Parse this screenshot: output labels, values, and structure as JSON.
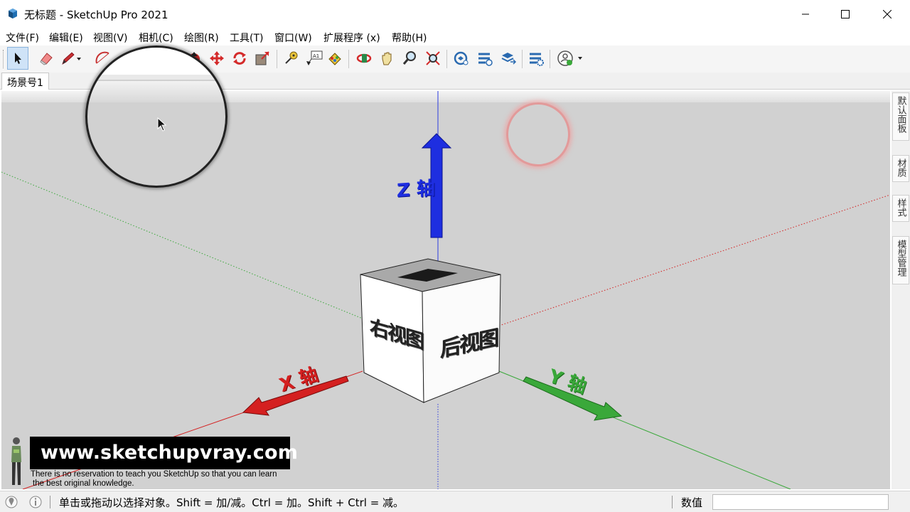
{
  "window": {
    "title": "无标题 - SketchUp Pro 2021"
  },
  "menu": [
    {
      "label": "文件(F)"
    },
    {
      "label": "编辑(E)"
    },
    {
      "label": "视图(V)"
    },
    {
      "label": "相机(C)"
    },
    {
      "label": "绘图(R)"
    },
    {
      "label": "工具(T)"
    },
    {
      "label": "窗口(W)"
    },
    {
      "label": "扩展程序 (x)"
    },
    {
      "label": "帮助(H)"
    }
  ],
  "toolbar": {
    "tools": [
      "select-icon",
      "eraser-icon",
      "pencil-icon",
      "arc-icon",
      "push-pull-icon",
      "move-icon",
      "rotate-icon",
      "scale-icon",
      "tape-measure-icon",
      "text-icon",
      "paint-bucket-icon",
      "orbit-icon",
      "pan-icon",
      "zoom-icon",
      "zoom-extents-icon",
      "warehouse-icon",
      "extension-warehouse-icon",
      "layout-send-icon",
      "extension-manager-icon",
      "account-icon"
    ]
  },
  "scenes": {
    "tabs": [
      {
        "label": "场景号1"
      }
    ]
  },
  "viewport": {
    "axis_labels": {
      "z": "Z 轴",
      "x": "X 轴",
      "y": "Y 轴"
    },
    "cube_faces": {
      "left": "右视图",
      "right": "后视图"
    },
    "colors": {
      "background": "#d1d1d1",
      "x_axis": "#d42020",
      "y_axis": "#3aa83a",
      "z_axis": "#2a3ae0"
    }
  },
  "side_panel": {
    "tabs": [
      "默认面板",
      "材质",
      "样式",
      "模型管理"
    ]
  },
  "status": {
    "message": "单击或拖动以选择对象。Shift = 加/减。Ctrl = 加。Shift + Ctrl = 减。",
    "measure_label": "数值",
    "measure_value": ""
  },
  "watermark": {
    "site": "www.sketchupvray.com",
    "tagline_1": "There is no reservation to teach you SketchUp so that you can learn",
    "tagline_2": "the best original knowledge."
  }
}
